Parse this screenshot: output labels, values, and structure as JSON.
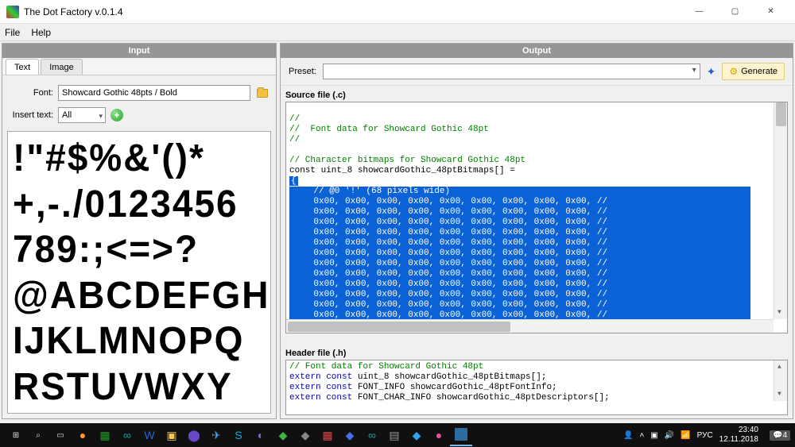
{
  "window": {
    "title": "The Dot Factory v.0.1.4",
    "menu": {
      "file": "File",
      "help": "Help"
    },
    "controls": {
      "min": "—",
      "max": "▢",
      "close": "✕"
    }
  },
  "left": {
    "header": "Input",
    "tabs": {
      "text": "Text",
      "image": "Image"
    },
    "font_label": "Font:",
    "font_value": "Showcard Gothic 48pts / Bold",
    "insert_label": "Insert text:",
    "insert_value": "All",
    "glyph_lines": [
      "!\"#$%&'()*",
      "+,-./0123456",
      "789:;<=>?",
      "@ABCDEFGH",
      "IJKLMNOPQ",
      "RSTUVWXY"
    ]
  },
  "right": {
    "header": "Output",
    "preset_label": "Preset:",
    "generate_label": "Generate",
    "source_header": "Source file (.c)",
    "header_header": "Header file (.h)",
    "src": {
      "l1": "//",
      "l2": "//  Font data for Showcard Gothic 48pt",
      "l3": "//",
      "l4": "// Character bitmaps for Showcard Gothic 48pt",
      "l5": "const uint_8 showcardGothic_48ptBitmaps[] =",
      "brace": "{",
      "sel_comment": "    // @0 '!' (68 pixels wide)",
      "sel_row": "    0x00, 0x00, 0x00, 0x00, 0x00, 0x00, 0x00, 0x00, 0x00, //",
      "sel_row_last": "    0x00, 0x00, 0x00, 0x00, 0x00, 0x00, 0x00, 0x00, 0x00,"
    },
    "hdr": {
      "l1": "// Font data for Showcard Gothic 48pt",
      "l2a": "extern const",
      "l2b": " uint_8 showcardGothic_48ptBitmaps[];",
      "l3a": "extern const",
      "l3b": " FONT_INFO showcardGothic_48ptFontInfo;",
      "l4a": "extern const",
      "l4b": " FONT_CHAR_INFO showcardGothic_48ptDescriptors[];"
    }
  },
  "taskbar": {
    "time": "23:40",
    "date": "12.11.2018",
    "lang": "РУС",
    "notif": "4"
  }
}
